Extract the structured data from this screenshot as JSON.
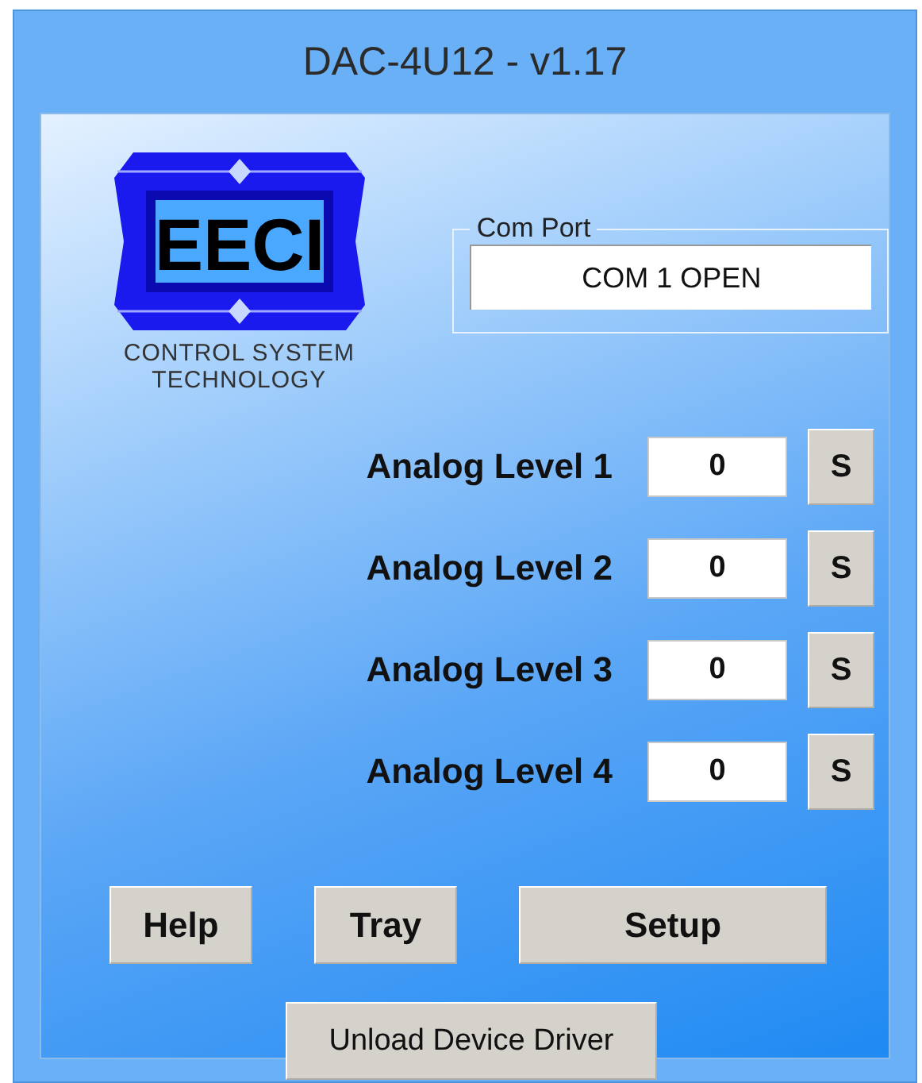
{
  "window": {
    "title": "DAC-4U12 - v1.17"
  },
  "logo": {
    "mark": "EECI",
    "tagline_1": "CONTROL SYSTEM",
    "tagline_2": "TECHNOLOGY"
  },
  "com_port": {
    "label": "Com Port",
    "value": "COM 1 OPEN"
  },
  "channels": [
    {
      "label": "Analog Level 1",
      "value": "0",
      "button": "S"
    },
    {
      "label": "Analog Level 2",
      "value": "0",
      "button": "S"
    },
    {
      "label": "Analog Level 3",
      "value": "0",
      "button": "S"
    },
    {
      "label": "Analog Level 4",
      "value": "0",
      "button": "S"
    }
  ],
  "buttons": [
    {
      "label": "Help",
      "kind": "small"
    },
    {
      "label": "Tray",
      "kind": "small"
    },
    {
      "label": "Setup",
      "kind": "wide"
    }
  ],
  "unload_button": {
    "label": "Unload Device Driver"
  }
}
